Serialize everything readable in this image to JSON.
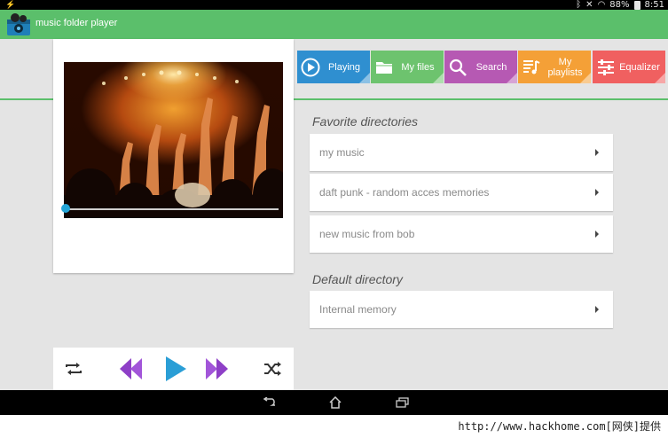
{
  "status_bar": {
    "battery": "88%",
    "time": "8:51"
  },
  "app": {
    "title": "music folder player"
  },
  "tabs": [
    {
      "label": "Playing",
      "icon": "play-circle-icon",
      "color": "#2f8fd0"
    },
    {
      "label": "My files",
      "icon": "folder-icon",
      "color": "#6dc36e"
    },
    {
      "label": "Search",
      "icon": "search-icon",
      "color": "#b659b3"
    },
    {
      "label": "My playlists",
      "icon": "playlist-icon",
      "color": "#f4a037"
    },
    {
      "label": "Equalizer",
      "icon": "equalizer-icon",
      "color": "#f06060"
    }
  ],
  "favorites": {
    "title": "Favorite directories",
    "items": [
      {
        "label": "my music"
      },
      {
        "label": "daft punk - random acces memories"
      },
      {
        "label": "new music from bob"
      }
    ]
  },
  "default_dir": {
    "title": "Default directory",
    "items": [
      {
        "label": "Internal memory"
      }
    ]
  },
  "player": {
    "progress": 0.0,
    "controls": [
      "repeat-icon",
      "previous-icon",
      "play-icon",
      "next-icon",
      "shuffle-icon"
    ]
  },
  "nav": [
    "back-icon",
    "home-icon",
    "recents-icon"
  ],
  "watermark": "http://www.hackhome.com[网侠]提供",
  "colors": {
    "accent": "#5bbf6b",
    "seek": "#25a6d8",
    "skip": "#8e3fc7",
    "play": "#2a9ed6"
  }
}
